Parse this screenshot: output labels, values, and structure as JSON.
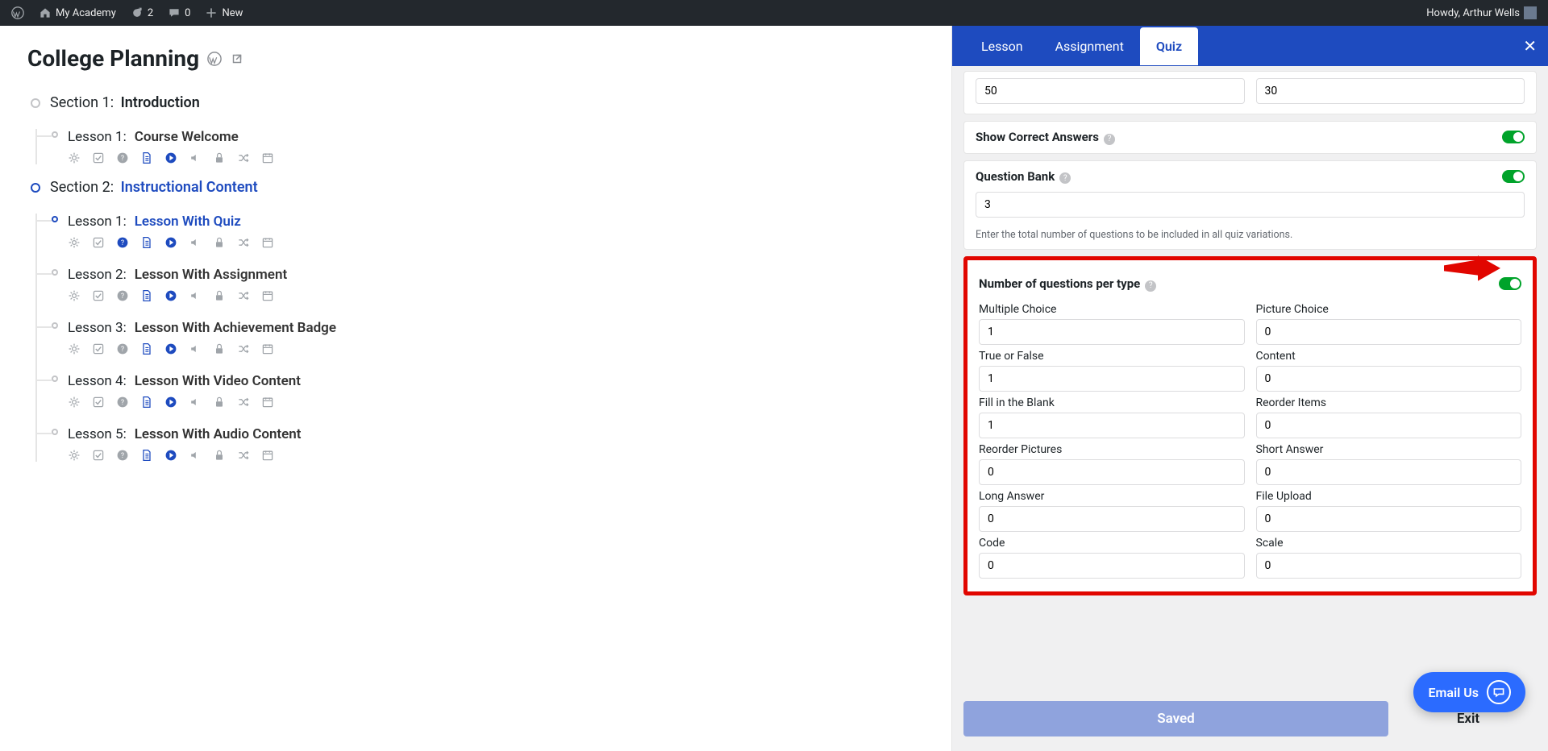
{
  "adminBar": {
    "site": "My Academy",
    "refresh": "2",
    "comments": "0",
    "new": "New",
    "greeting": "Howdy, Arthur Wells"
  },
  "page": {
    "title": "College Planning"
  },
  "sections": [
    {
      "label": "Section 1:",
      "title": "Introduction",
      "active": false,
      "lessons": [
        {
          "label": "Lesson 1:",
          "title": "Course Welcome",
          "active": false
        }
      ]
    },
    {
      "label": "Section 2:",
      "title": "Instructional Content",
      "active": true,
      "lessons": [
        {
          "label": "Lesson 1:",
          "title": "Lesson With Quiz",
          "active": true
        },
        {
          "label": "Lesson 2:",
          "title": "Lesson With Assignment",
          "active": false
        },
        {
          "label": "Lesson 3:",
          "title": "Lesson With Achievement Badge",
          "active": false
        },
        {
          "label": "Lesson 4:",
          "title": "Lesson With Video Content",
          "active": false
        },
        {
          "label": "Lesson 5:",
          "title": "Lesson With Audio Content",
          "active": false
        }
      ]
    }
  ],
  "tabs": {
    "lesson": "Lesson",
    "assignment": "Assignment",
    "quiz": "Quiz"
  },
  "panel": {
    "topValueLeft": "50",
    "topValueRight": "30",
    "showCorrect": "Show Correct Answers",
    "questionBank": "Question Bank",
    "questionBankValue": "3",
    "questionBankHint": "Enter the total number of questions to be included in all quiz variations.",
    "perTypeHeader": "Number of questions per type",
    "types": [
      {
        "label": "Multiple Choice",
        "value": "1"
      },
      {
        "label": "Picture Choice",
        "value": "0"
      },
      {
        "label": "True or False",
        "value": "1"
      },
      {
        "label": "Content",
        "value": "0"
      },
      {
        "label": "Fill in the Blank",
        "value": "1"
      },
      {
        "label": "Reorder Items",
        "value": "0"
      },
      {
        "label": "Reorder Pictures",
        "value": "0"
      },
      {
        "label": "Short Answer",
        "value": "0"
      },
      {
        "label": "Long Answer",
        "value": "0"
      },
      {
        "label": "File Upload",
        "value": "0"
      },
      {
        "label": "Code",
        "value": "0"
      },
      {
        "label": "Scale",
        "value": "0"
      }
    ],
    "saved": "Saved",
    "exit": "Exit"
  },
  "emailUs": "Email Us"
}
